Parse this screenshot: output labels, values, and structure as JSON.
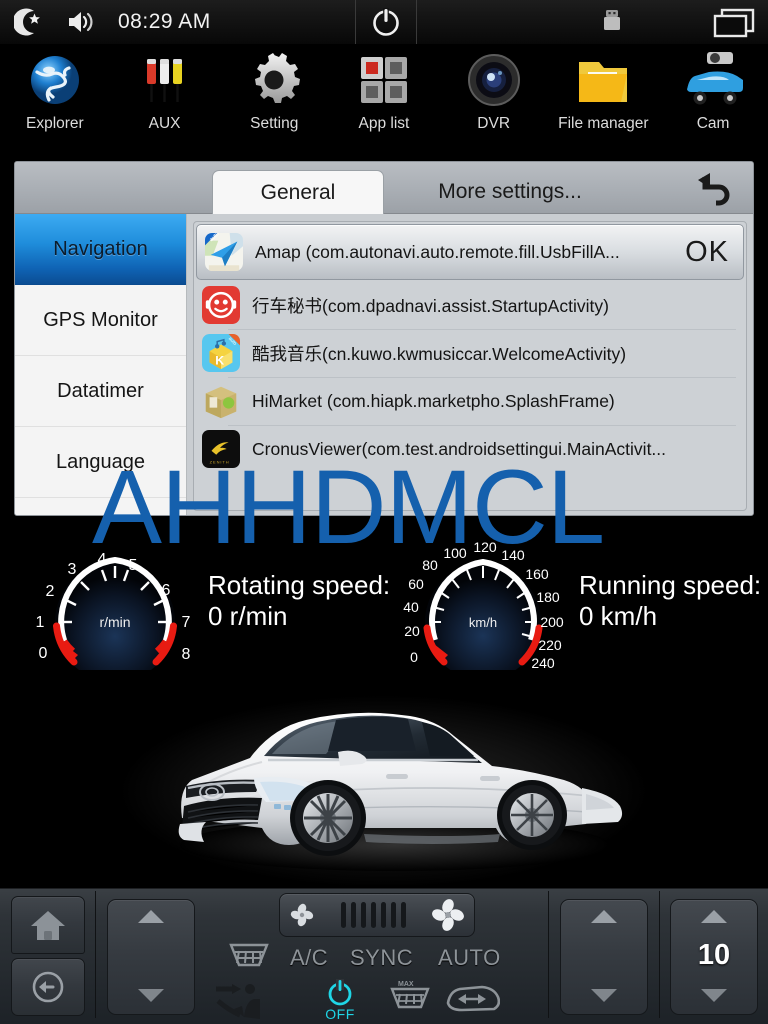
{
  "status_bar": {
    "clock": "08:29 AM",
    "icons": [
      "moon-star-icon",
      "volume-icon",
      "power-icon",
      "usb-icon",
      "windows-icon"
    ]
  },
  "app_shortcuts": [
    {
      "label": "Explorer",
      "icon": "globe-icon"
    },
    {
      "label": "AUX",
      "icon": "rca-jack-icon"
    },
    {
      "label": "Setting",
      "icon": "gear-icon"
    },
    {
      "label": "App list",
      "icon": "grid-squares-icon"
    },
    {
      "label": "DVR",
      "icon": "camera-lens-icon"
    },
    {
      "label": "File manager",
      "icon": "folder-icon"
    },
    {
      "label": "Cam",
      "icon": "car-camera-icon"
    }
  ],
  "settings": {
    "tabs": [
      {
        "label": "General",
        "selected": true
      },
      {
        "label": "More settings...",
        "selected": false
      }
    ],
    "back_icon": "back-arrow-icon",
    "sidebar": [
      {
        "label": "Navigation",
        "selected": true
      },
      {
        "label": "GPS Monitor",
        "selected": false
      },
      {
        "label": "Datatimer",
        "selected": false
      },
      {
        "label": "Language",
        "selected": false
      }
    ],
    "ok_label": "OK",
    "app_list": [
      {
        "label": "Amap (com.autonavi.auto.remote.fill.UsbFillA...",
        "icon": "amap-icon",
        "selected": true
      },
      {
        "label": "行车秘书(com.dpadnavi.assist.StartupActivity)",
        "icon": "smiley-icon",
        "selected": false
      },
      {
        "label": "酷我音乐(cn.kuwo.kwmusiccar.WelcomeActivity)",
        "icon": "kuwo-icon",
        "selected": false
      },
      {
        "label": "HiMarket (com.hiapk.marketpho.SplashFrame)",
        "icon": "himarket-icon",
        "selected": false
      },
      {
        "label": "CronusViewer(com.test.androidsettingui.MainActivit...",
        "icon": "cronus-icon",
        "selected": false
      }
    ]
  },
  "watermark": {
    "text": "AHHDMCL",
    "color": "#1560ad"
  },
  "gauges": {
    "rpm": {
      "unit": "r/min",
      "ticks": [
        "0",
        "1",
        "2",
        "3",
        "4",
        "5",
        "6",
        "7",
        "8"
      ],
      "label": "Rotating speed:",
      "value": "0 r/min",
      "current": 0,
      "min": 0,
      "max": 8
    },
    "speed": {
      "unit": "km/h",
      "ticks": [
        "0",
        "20",
        "40",
        "60",
        "80",
        "100",
        "120",
        "140",
        "160",
        "180",
        "200",
        "220",
        "240"
      ],
      "label": "Running speed:",
      "value": "0 km/h",
      "current": 0,
      "min": 0,
      "max": 240
    }
  },
  "car_image": {
    "alt": "white-sedan-car"
  },
  "climate": {
    "home_icon": "home-icon",
    "back_icon": "back-circle-icon",
    "fan_icon_small": "fan-small-icon",
    "fan_icon_large": "fan-large-icon",
    "fan_level_ticks": 7,
    "labels": {
      "ac": "A/C",
      "sync": "SYNC",
      "auto": "AUTO",
      "power_state": "OFF"
    },
    "icons": [
      "rear-defrost-icon",
      "airflow-seat-icon",
      "front-defrost-max-icon",
      "recirculation-icon"
    ],
    "left_temp": "",
    "right_temp": "10"
  }
}
